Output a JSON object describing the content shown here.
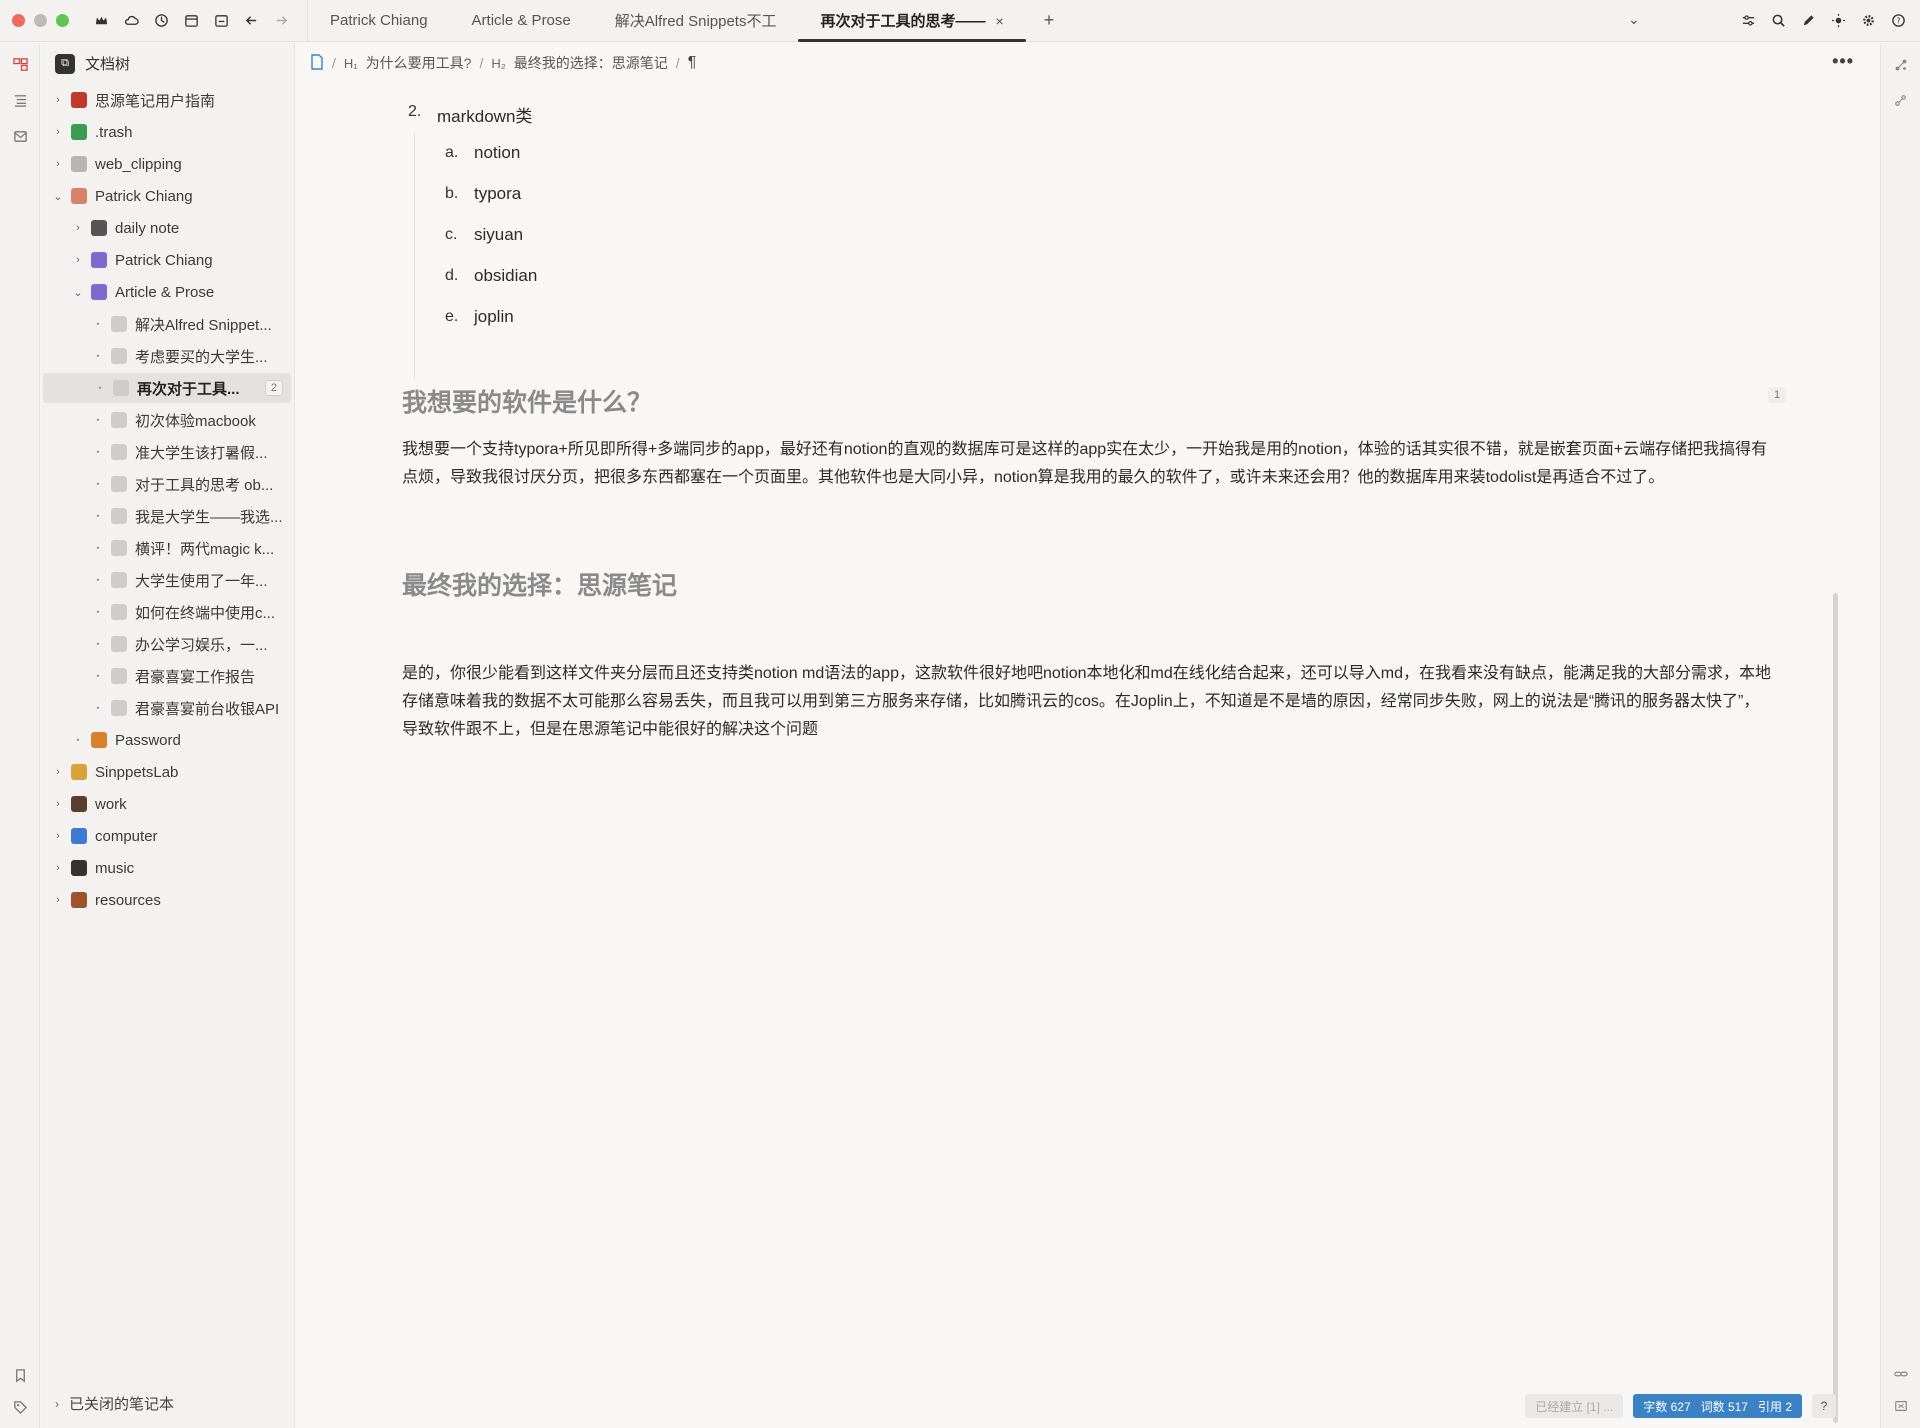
{
  "window": {
    "tabs": [
      {
        "label": "Patrick Chiang"
      },
      {
        "label": "Article & Prose"
      },
      {
        "label": "解决Alfred Snippets不工"
      },
      {
        "label": "再次对于工具的思考——",
        "active": true
      }
    ],
    "tab_close": "×",
    "tab_add": "+"
  },
  "sidebar": {
    "title": "文档树",
    "items": [
      {
        "label": "思源笔记用户指南",
        "level": 0,
        "arrow": "›",
        "icon_color": "#c0392b"
      },
      {
        "label": ".trash",
        "level": 0,
        "arrow": "›",
        "icon_color": "#3a9d4f"
      },
      {
        "label": "web_clipping",
        "level": 0,
        "arrow": "›",
        "icon_color": "#b9b6b2"
      },
      {
        "label": "Patrick Chiang",
        "level": 0,
        "arrow": "⌄",
        "icon_color": "#d9826b"
      },
      {
        "label": "daily note",
        "level": 1,
        "arrow": "›",
        "icon_color": "#555555"
      },
      {
        "label": "Patrick Chiang",
        "level": 1,
        "arrow": "›",
        "icon_color": "#7b6bd1"
      },
      {
        "label": "Article & Prose",
        "level": 1,
        "arrow": "⌄",
        "icon_color": "#7b6bd1"
      },
      {
        "label": "解决Alfred Snippet...",
        "level": 2,
        "arrow": "•"
      },
      {
        "label": "考虑要买的大学生...",
        "level": 2,
        "arrow": "•"
      },
      {
        "label": "再次对于工具...",
        "level": 2,
        "arrow": "•",
        "selected": true,
        "count": "2"
      },
      {
        "label": "初次体验macbook",
        "level": 2,
        "arrow": "•"
      },
      {
        "label": "准大学生该打暑假...",
        "level": 2,
        "arrow": "•"
      },
      {
        "label": "对于工具的思考 ob...",
        "level": 2,
        "arrow": "•"
      },
      {
        "label": "我是大学生——我选...",
        "level": 2,
        "arrow": "•"
      },
      {
        "label": "横评！两代magic k...",
        "level": 2,
        "arrow": "•"
      },
      {
        "label": "大学生使用了一年...",
        "level": 2,
        "arrow": "•"
      },
      {
        "label": "如何在终端中使用c...",
        "level": 2,
        "arrow": "•"
      },
      {
        "label": "办公学习娱乐，一...",
        "level": 2,
        "arrow": "•"
      },
      {
        "label": "君豪喜宴工作报告",
        "level": 2,
        "arrow": "•"
      },
      {
        "label": "君豪喜宴前台收银API",
        "level": 2,
        "arrow": "•"
      },
      {
        "label": "Password",
        "level": 1,
        "arrow": "•",
        "icon_color": "#d9822b"
      },
      {
        "label": "SinppetsLab",
        "level": 0,
        "arrow": "›",
        "icon_color": "#d9a23b"
      },
      {
        "label": "work",
        "level": 0,
        "arrow": "›",
        "icon_color": "#5a3d2b"
      },
      {
        "label": "computer",
        "level": 0,
        "arrow": "›",
        "icon_color": "#3b7bd1"
      },
      {
        "label": "music",
        "level": 0,
        "arrow": "›",
        "icon_color": "#333333"
      },
      {
        "label": "resources",
        "level": 0,
        "arrow": "›",
        "icon_color": "#a0522d"
      }
    ],
    "footer": "已关闭的笔记本"
  },
  "breadcrumb": {
    "h1_tag": "H₁",
    "h1": "为什么要用工具?",
    "h2_tag": "H₂",
    "h2": "最终我的选择：思源笔记",
    "pilcrow": "¶"
  },
  "doc": {
    "list_num": "2.",
    "list_title": "markdown类",
    "sub_items": [
      {
        "mark": "a.",
        "text": "notion"
      },
      {
        "mark": "b.",
        "text": "typora"
      },
      {
        "mark": "c.",
        "text": "siyuan"
      },
      {
        "mark": "d.",
        "text": "obsidian"
      },
      {
        "mark": "e.",
        "text": "joplin"
      }
    ],
    "heading1": "我想要的软件是什么？",
    "heading1_ref": "1",
    "para1": "我想要一个支持typora+所见即所得+多端同步的app，最好还有notion的直观的数据库可是这样的app实在太少，一开始我是用的notion，体验的话其实很不错，就是嵌套页面+云端存储把我搞得有点烦，导致我很讨厌分页，把很多东西都塞在一个页面里。其他软件也是大同小异，notion算是我用的最久的软件了，或许未来还会用？他的数据库用来装todolist是再适合不过了。",
    "heading2": "最终我的选择：思源笔记",
    "para2": "是的，你很少能看到这样文件夹分层而且还支持类notion md语法的app，这款软件很好地吧notion本地化和md在线化结合起来，还可以导入md，在我看来没有缺点，能满足我的大部分需求，本地存储意味着我的数据不太可能那么容易丢失，而且我可以用到第三方服务来存储，比如腾讯云的cos。在Joplin上，不知道是不是墙的原因，经常同步失败，网上的说法是“腾讯的服务器太快了”，导致软件跟不上，但是在思源笔记中能很好的解决这个问题"
  },
  "status": {
    "backlink": "已经建立 [1] ...",
    "chars": "字数 627",
    "words": "词数 517",
    "refs": "引用 2",
    "help": "?"
  },
  "colors": {
    "accent": "#d2453a",
    "status_blue": "#3b82c4",
    "heading_grey": "#8a8a8a"
  }
}
